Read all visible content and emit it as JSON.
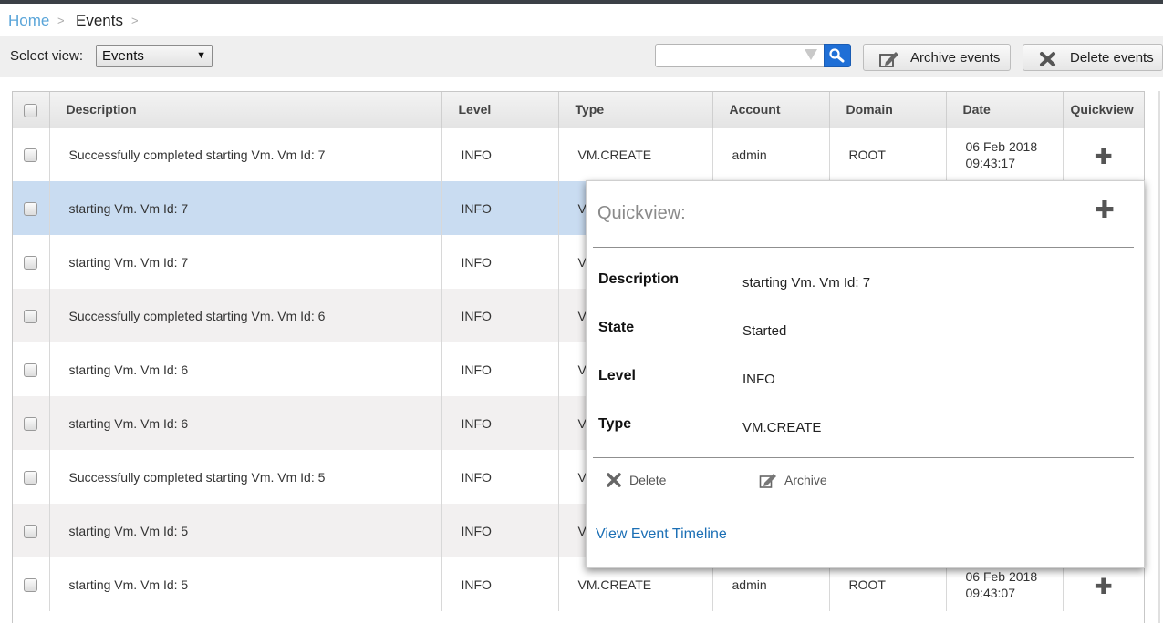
{
  "breadcrumb": {
    "home": "Home",
    "current": "Events",
    "separator": ">"
  },
  "toolbar": {
    "select_view_label": "Select view:",
    "select_view_value": "Events",
    "search_placeholder": "",
    "archive_label": "Archive events",
    "delete_label": "Delete events"
  },
  "table": {
    "headers": [
      "Description",
      "Level",
      "Type",
      "Account",
      "Domain",
      "Date",
      "Quickview"
    ],
    "rows": [
      {
        "description": "Successfully completed starting Vm. Vm Id: 7",
        "level": "INFO",
        "type": "VM.CREATE",
        "account": "admin",
        "domain": "ROOT",
        "date": "06 Feb 2018 09:43:17"
      },
      {
        "description": "starting Vm. Vm Id: 7",
        "level": "INFO",
        "type": "VM.CREATE",
        "account": "",
        "domain": "",
        "date": ""
      },
      {
        "description": "starting Vm. Vm Id: 7",
        "level": "INFO",
        "type": "VM.CREATE",
        "account": "",
        "domain": "",
        "date": ""
      },
      {
        "description": "Successfully completed starting Vm. Vm Id: 6",
        "level": "INFO",
        "type": "VM.CREATE",
        "account": "",
        "domain": "",
        "date": ""
      },
      {
        "description": "starting Vm. Vm Id: 6",
        "level": "INFO",
        "type": "VM.CREATE",
        "account": "",
        "domain": "",
        "date": ""
      },
      {
        "description": "starting Vm. Vm Id: 6",
        "level": "INFO",
        "type": "VM.CREATE",
        "account": "",
        "domain": "",
        "date": ""
      },
      {
        "description": "Successfully completed starting Vm. Vm Id: 5",
        "level": "INFO",
        "type": "VM.CREATE",
        "account": "",
        "domain": "",
        "date": ""
      },
      {
        "description": "starting Vm. Vm Id: 5",
        "level": "INFO",
        "type": "VM.CREATE",
        "account": "",
        "domain": "",
        "date": ""
      },
      {
        "description": "starting Vm. Vm Id: 5",
        "level": "INFO",
        "type": "VM.CREATE",
        "account": "admin",
        "domain": "ROOT",
        "date": "06 Feb 2018 09:43:07"
      }
    ]
  },
  "quickview": {
    "title": "Quickview:",
    "fields": [
      {
        "key": "Description",
        "value": "starting Vm. Vm Id: 7"
      },
      {
        "key": "State",
        "value": "Started"
      },
      {
        "key": "Level",
        "value": "INFO"
      },
      {
        "key": "Type",
        "value": "VM.CREATE"
      }
    ],
    "delete_label": "Delete",
    "archive_label": "Archive",
    "timeline_link": "View Event Timeline"
  },
  "colors": {
    "link": "#1b6fb5",
    "selected_row": "#c9dcf1",
    "search_button": "#1f6fd6"
  },
  "icons": {
    "search": "magnifier-icon",
    "archive": "pencil-edit-icon",
    "delete": "x-icon",
    "quickview": "plus-icon"
  }
}
